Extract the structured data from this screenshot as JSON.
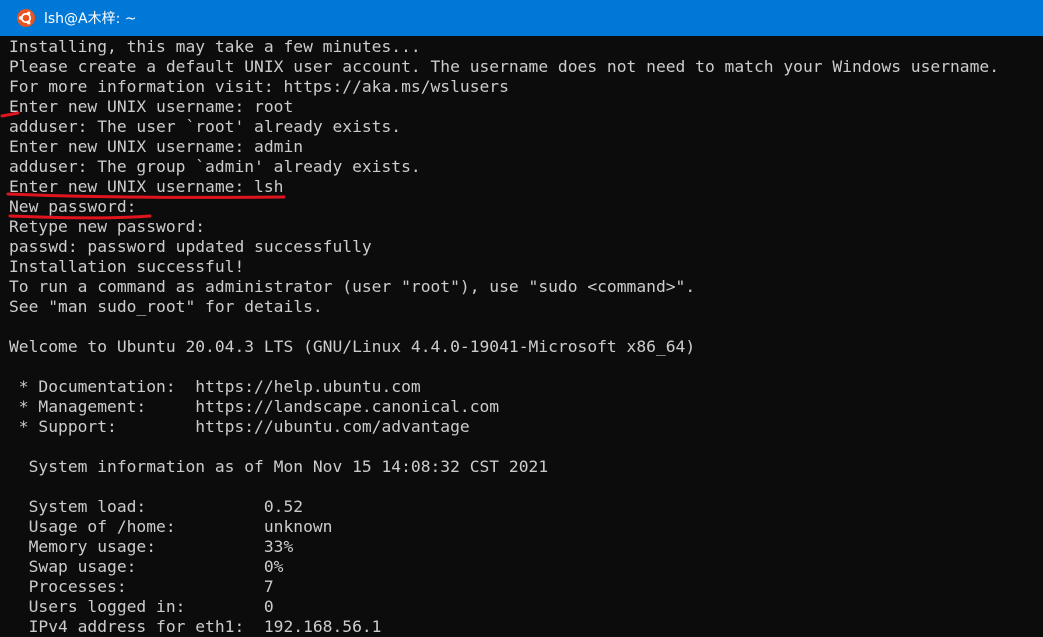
{
  "window": {
    "title": "lsh@A木梓: ~",
    "icon": "ubuntu-icon",
    "accent_color": "#0078d7"
  },
  "terminal": {
    "lines": [
      "Installing, this may take a few minutes...",
      "Please create a default UNIX user account. The username does not need to match your Windows username.",
      "For more information visit: https://aka.ms/wslusers",
      "Enter new UNIX username: root",
      "adduser: The user `root' already exists.",
      "Enter new UNIX username: admin",
      "adduser: The group `admin' already exists.",
      "Enter new UNIX username: lsh",
      "New password:",
      "Retype new password:",
      "passwd: password updated successfully",
      "Installation successful!",
      "To run a command as administrator (user \"root\"), use \"sudo <command>\".",
      "See \"man sudo_root\" for details.",
      "",
      "Welcome to Ubuntu 20.04.3 LTS (GNU/Linux 4.4.0-19041-Microsoft x86_64)",
      "",
      " * Documentation:  https://help.ubuntu.com",
      " * Management:     https://landscape.canonical.com",
      " * Support:        https://ubuntu.com/advantage",
      "",
      "  System information as of Mon Nov 15 14:08:32 CST 2021",
      "",
      "  System load:            0.52",
      "  Usage of /home:         unknown",
      "  Memory usage:           33%",
      "  Swap usage:             0%",
      "  Processes:              7",
      "  Users logged in:        0",
      "  IPv4 address for eth1:  192.168.56.1"
    ],
    "text_color": "#cccccc",
    "background_color": "#0c0c0c",
    "annotation_color": "#e0141e"
  }
}
